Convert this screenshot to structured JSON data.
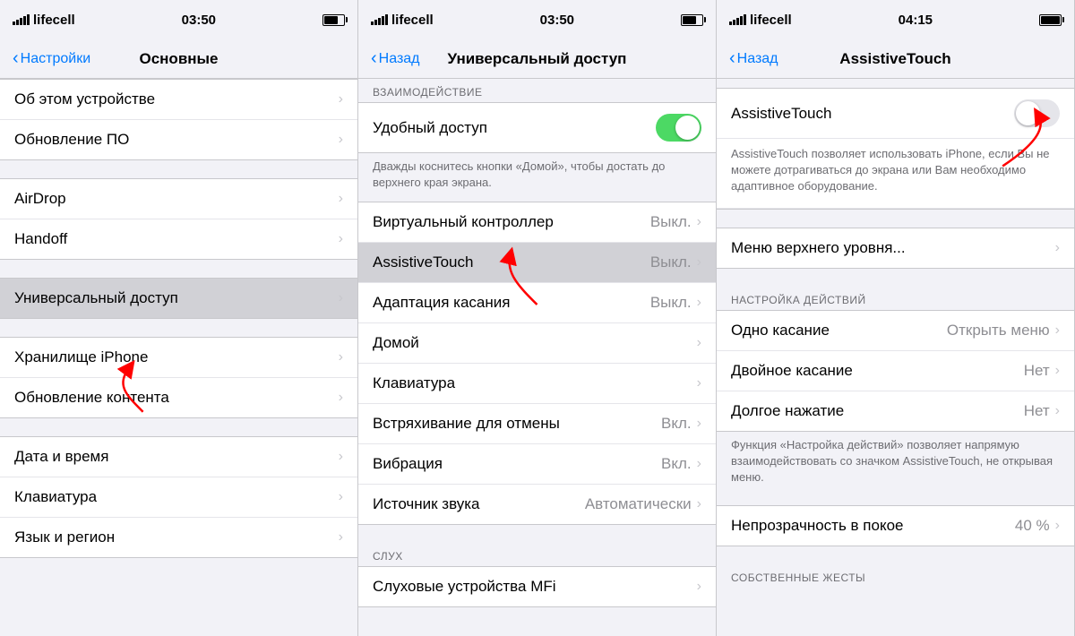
{
  "panels": [
    {
      "id": "panel1",
      "statusBar": {
        "left": "lifecell",
        "center": "03:50",
        "right": "battery"
      },
      "navBar": {
        "backLabel": "Настройки",
        "title": "Основные"
      },
      "groups": [
        {
          "items": [
            {
              "label": "Об этом устройстве",
              "value": "",
              "hasChevron": true
            },
            {
              "label": "Обновление ПО",
              "value": "",
              "hasChevron": true
            }
          ]
        },
        {
          "items": [
            {
              "label": "AirDrop",
              "value": "",
              "hasChevron": true
            },
            {
              "label": "Handoff",
              "value": "",
              "hasChevron": true
            }
          ]
        },
        {
          "items": [
            {
              "label": "Универсальный доступ",
              "value": "",
              "hasChevron": true,
              "highlighted": true
            }
          ]
        },
        {
          "items": [
            {
              "label": "Хранилище iPhone",
              "value": "",
              "hasChevron": true
            },
            {
              "label": "Обновление контента",
              "value": "",
              "hasChevron": true
            }
          ]
        },
        {
          "items": [
            {
              "label": "Дата и время",
              "value": "",
              "hasChevron": true
            },
            {
              "label": "Клавиатура",
              "value": "",
              "hasChevron": true
            },
            {
              "label": "Язык и регион",
              "value": "",
              "hasChevron": true
            }
          ]
        }
      ]
    },
    {
      "id": "panel2",
      "statusBar": {
        "left": "lifecell",
        "center": "03:50",
        "right": "battery"
      },
      "navBar": {
        "backLabel": "Назад",
        "title": "Универсальный доступ"
      },
      "sections": [
        {
          "header": "ВЗАИМОДЕЙСТВИЕ",
          "items": [
            {
              "label": "Удобный доступ",
              "value": "",
              "toggle": true,
              "toggleOn": true
            },
            {
              "desc": "Дважды коснитесь кнопки «Домой», чтобы достать до верхнего края экрана."
            }
          ]
        },
        {
          "header": "",
          "items": [
            {
              "label": "Виртуальный контроллер",
              "value": "Выкл.",
              "hasChevron": true
            },
            {
              "label": "AssistiveTouch",
              "value": "Выкл.",
              "hasChevron": true,
              "highlighted": true
            },
            {
              "label": "Адаптация касания",
              "value": "Выкл.",
              "hasChevron": true
            },
            {
              "label": "Домой",
              "value": "",
              "hasChevron": true
            },
            {
              "label": "Клавиатура",
              "value": "",
              "hasChevron": true
            },
            {
              "label": "Встряхивание для отмены",
              "value": "Вкл.",
              "hasChevron": true
            },
            {
              "label": "Вибрация",
              "value": "Вкл.",
              "hasChevron": true
            },
            {
              "label": "Источник звука",
              "value": "Автоматически",
              "hasChevron": true
            }
          ]
        },
        {
          "header": "СЛУХ",
          "items": [
            {
              "label": "Слуховые устройства MFi",
              "value": "",
              "hasChevron": true
            }
          ]
        }
      ]
    },
    {
      "id": "panel3",
      "statusBar": {
        "left": "lifecell",
        "center": "04:15",
        "right": "battery-full"
      },
      "navBar": {
        "backLabel": "Назад",
        "title": "AssistiveTouch"
      },
      "topSection": {
        "label": "AssistiveTouch",
        "toggleOn": false,
        "desc": "AssistiveTouch позволяет использовать iPhone, если Вы не можете дотрагиваться до экрана или Вам необходимо адаптивное оборудование."
      },
      "menuItem": {
        "label": "Меню верхнего уровня...",
        "hasChevron": true
      },
      "actionsHeader": "НАСТРОЙКА ДЕЙСТВИЙ",
      "actions": [
        {
          "label": "Одно касание",
          "value": "Открыть меню",
          "hasChevron": true
        },
        {
          "label": "Двойное касание",
          "value": "Нет",
          "hasChevron": true
        },
        {
          "label": "Долгое нажатие",
          "value": "Нет",
          "hasChevron": true
        }
      ],
      "actionsDesc": "Функция «Настройка действий» позволяет напрямую взаимодействовать со значком AssistiveTouch, не открывая меню.",
      "opacityItem": {
        "label": "Непрозрачность в покое",
        "value": "40 %",
        "hasChevron": true
      },
      "gesturesHeader": "СОБСТВЕННЫЕ ЖЕСТЫ"
    }
  ]
}
